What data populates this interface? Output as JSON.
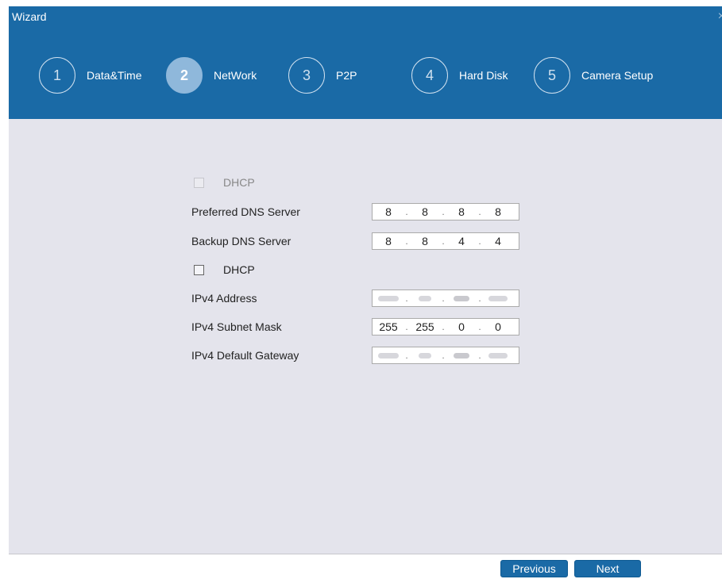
{
  "window": {
    "title": "Wizard",
    "close_glyph": "×"
  },
  "steps": [
    {
      "number": "1",
      "label": "Data&Time",
      "active": false
    },
    {
      "number": "2",
      "label": "NetWork",
      "active": true
    },
    {
      "number": "3",
      "label": "P2P",
      "active": false
    },
    {
      "number": "4",
      "label": "Hard Disk",
      "active": false
    },
    {
      "number": "5",
      "label": "Camera Setup",
      "active": false
    }
  ],
  "dns": {
    "dhcp_label": "DHCP",
    "preferred_label": "Preferred DNS Server",
    "preferred_value": [
      "8",
      "8",
      "8",
      "8"
    ],
    "backup_label": "Backup DNS Server",
    "backup_value": [
      "8",
      "8",
      "4",
      "4"
    ]
  },
  "ipv4": {
    "dhcp_label": "DHCP",
    "address_label": "IPv4 Address",
    "subnet_label": "IPv4 Subnet Mask",
    "subnet_value": [
      "255",
      "255",
      "0",
      "0"
    ],
    "gateway_label": "IPv4 Default Gateway"
  },
  "footer": {
    "previous_label": "Previous",
    "next_label": "Next"
  },
  "colors": {
    "header": "#1a6aa6",
    "content": "#e4e4ec",
    "button": "#1a6aa6"
  }
}
